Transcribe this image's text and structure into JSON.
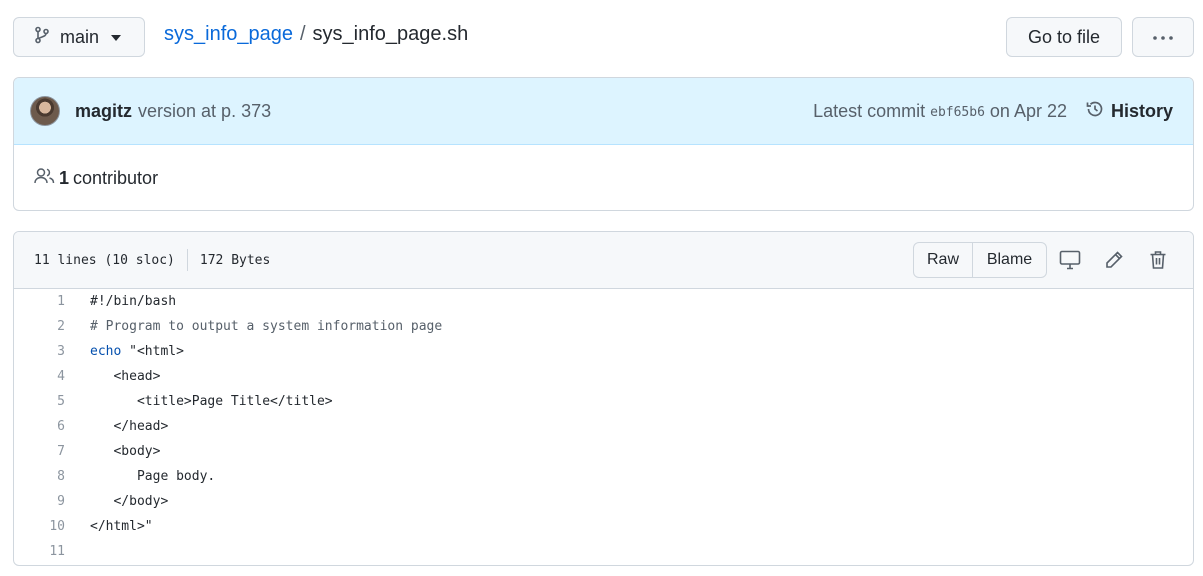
{
  "toolbar": {
    "branch_label": "main",
    "go_to_file_label": "Go to file",
    "more_label": "···"
  },
  "breadcrumb": {
    "repo": "sys_info_page",
    "separator": "/",
    "file": "sys_info_page.sh"
  },
  "commit": {
    "author": "magitz",
    "message": "version at p. 373",
    "latest_label": "Latest commit",
    "sha": "ebf65b6",
    "date": "on Apr 22",
    "history_label": "History",
    "contributors_count": "1",
    "contributors_label": "contributor"
  },
  "file": {
    "lines_info": "11 lines (10 sloc)",
    "size": "172 Bytes",
    "raw_label": "Raw",
    "blame_label": "Blame",
    "icons": [
      "desktop-icon",
      "pencil-icon",
      "trash-icon"
    ]
  },
  "code": [
    {
      "n": "1",
      "pre": "",
      "kw": "",
      "text": "#!/bin/bash",
      "style": "plain"
    },
    {
      "n": "2",
      "pre": "",
      "kw": "",
      "text": "# Program to output a system information page",
      "style": "comment"
    },
    {
      "n": "3",
      "pre": "",
      "kw": "echo",
      "text": " \"<html>",
      "style": "plain"
    },
    {
      "n": "4",
      "pre": "   ",
      "kw": "",
      "text": "<head>",
      "style": "plain"
    },
    {
      "n": "5",
      "pre": "      ",
      "kw": "",
      "text": "<title>Page Title</title>",
      "style": "plain"
    },
    {
      "n": "6",
      "pre": "   ",
      "kw": "",
      "text": "</head>",
      "style": "plain"
    },
    {
      "n": "7",
      "pre": "   ",
      "kw": "",
      "text": "<body>",
      "style": "plain"
    },
    {
      "n": "8",
      "pre": "      ",
      "kw": "",
      "text": "Page body.",
      "style": "plain"
    },
    {
      "n": "9",
      "pre": "   ",
      "kw": "",
      "text": "</body>",
      "style": "plain"
    },
    {
      "n": "10",
      "pre": "",
      "kw": "",
      "text": "</html>\"",
      "style": "plain"
    },
    {
      "n": "11",
      "pre": "",
      "kw": "",
      "text": "",
      "style": "plain"
    }
  ],
  "colors": {
    "link": "#0969da",
    "commit_bg": "#ddf4ff",
    "border": "#d0d7de",
    "keyword": "#0550ae"
  }
}
